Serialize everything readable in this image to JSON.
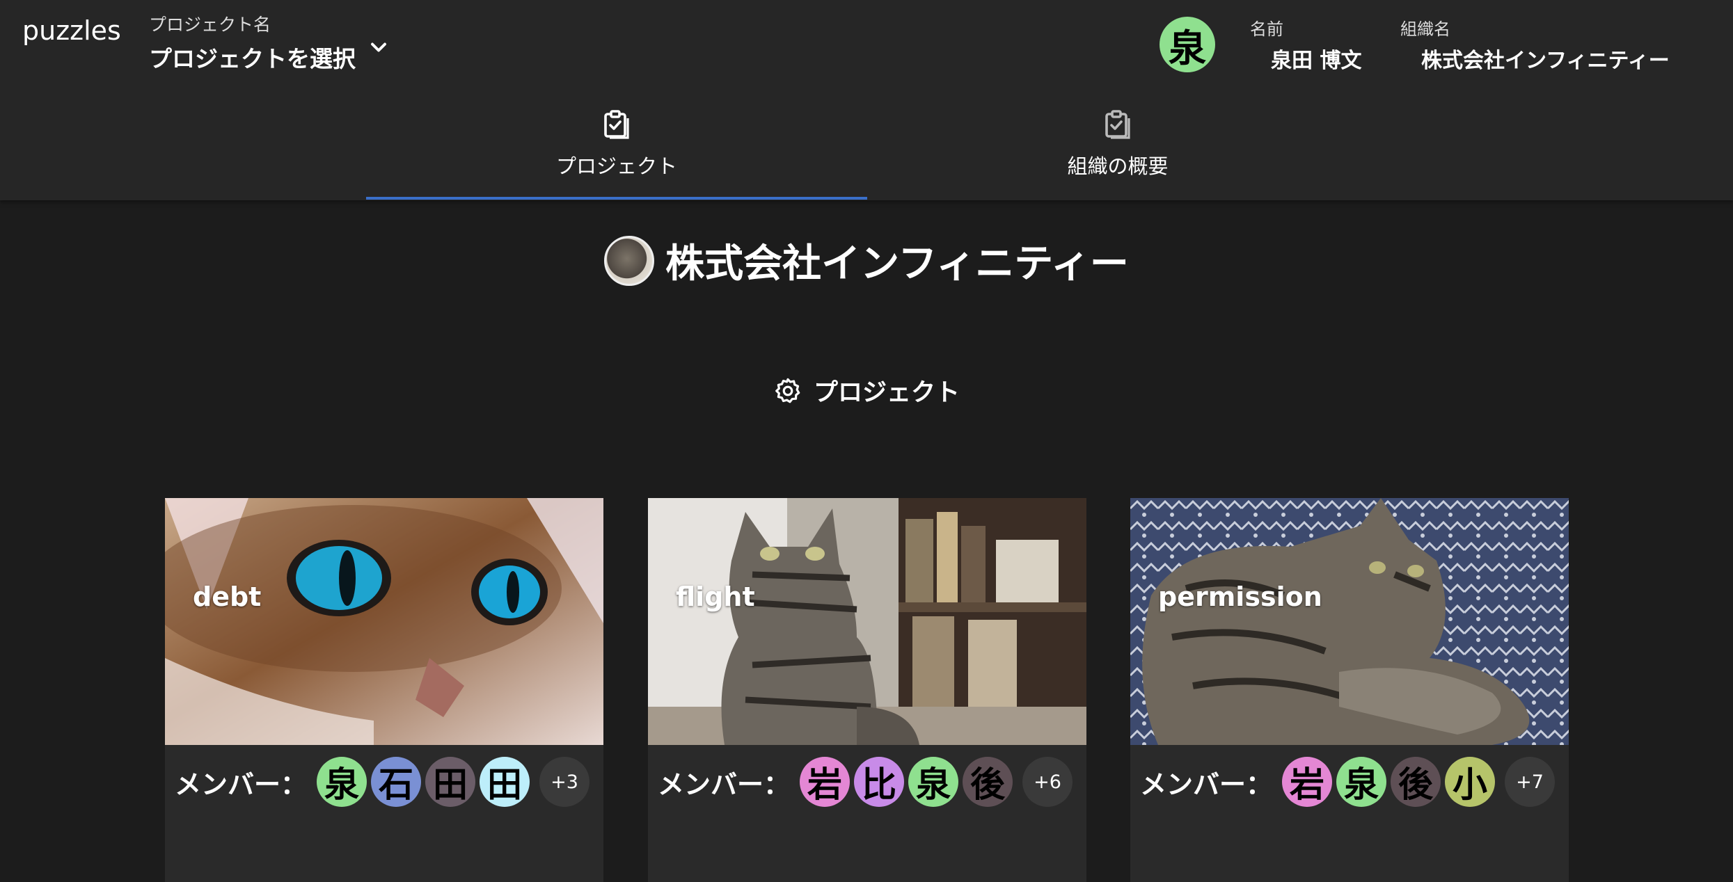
{
  "app": {
    "brand": "puzzles"
  },
  "header": {
    "project_label": "プロジェクト名",
    "project_value": "プロジェクトを選択",
    "user_avatar_char": "泉",
    "user_avatar_color": "#8fe08f",
    "name_label": "名前",
    "name_value": "泉田 博文",
    "org_label": "組織名",
    "org_value": "株式会社インフィニティー"
  },
  "tabs": [
    {
      "label": "プロジェクト",
      "icon": "clipboard-check-icon",
      "active": true
    },
    {
      "label": "組織の概要",
      "icon": "clipboard-check-icon",
      "active": false
    }
  ],
  "accent_color": "#3a6fc9",
  "org_heading": {
    "title": "株式会社インフィニティー"
  },
  "section": {
    "title": "プロジェクト",
    "icon": "gear-icon"
  },
  "projects": [
    {
      "name": "debt",
      "member_label": "メンバー：",
      "members": [
        {
          "char": "泉",
          "color": "#8fe08f"
        },
        {
          "char": "石",
          "color": "#7a90d4"
        },
        {
          "char": "田",
          "color": "#6b5d68"
        },
        {
          "char": "田",
          "color": "#bdeefa"
        }
      ],
      "more": "+3"
    },
    {
      "name": "flight",
      "member_label": "メンバー：",
      "members": [
        {
          "char": "岩",
          "color": "#e487d4"
        },
        {
          "char": "比",
          "color": "#c88be8"
        },
        {
          "char": "泉",
          "color": "#8fe08f"
        },
        {
          "char": "後",
          "color": "#5e4f55"
        }
      ],
      "more": "+6"
    },
    {
      "name": "permission",
      "member_label": "メンバー：",
      "members": [
        {
          "char": "岩",
          "color": "#e487d4"
        },
        {
          "char": "泉",
          "color": "#8fe08f"
        },
        {
          "char": "後",
          "color": "#5e4f55"
        },
        {
          "char": "小",
          "color": "#b6c46a"
        }
      ],
      "more": "+7"
    }
  ]
}
